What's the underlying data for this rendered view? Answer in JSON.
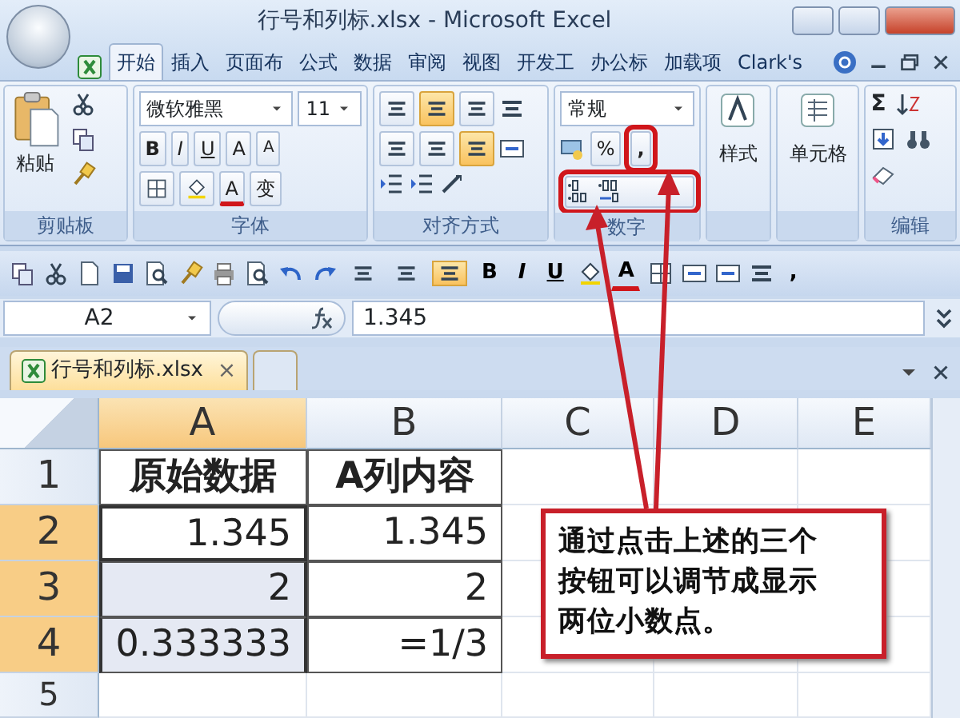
{
  "window": {
    "title": "行号和列标.xlsx - Microsoft Excel"
  },
  "tabs": [
    {
      "label": "开始",
      "selected": true
    },
    {
      "label": "插入",
      "selected": false
    },
    {
      "label": "页面布",
      "selected": false
    },
    {
      "label": "公式",
      "selected": false
    },
    {
      "label": "数据",
      "selected": false
    },
    {
      "label": "审阅",
      "selected": false
    },
    {
      "label": "视图",
      "selected": false
    },
    {
      "label": "开发工",
      "selected": false
    },
    {
      "label": "办公标",
      "selected": false
    },
    {
      "label": "加载项",
      "selected": false
    },
    {
      "label": "Clark's",
      "selected": false
    }
  ],
  "ribbon": {
    "groups": [
      {
        "kind": "clipboard",
        "label": "剪贴板",
        "paste": "粘贴"
      },
      {
        "kind": "font",
        "label": "字体",
        "font_name": "微软雅黑",
        "font_size": "11",
        "bold": "B",
        "italic": "I",
        "underline": "U",
        "grow": "A",
        "shrink": "A",
        "font_color": "A",
        "phonetic": "变"
      },
      {
        "kind": "alignment",
        "label": "对齐方式",
        "vertical": [
          {
            "selected": false
          },
          {
            "selected": true
          },
          {
            "selected": false
          }
        ],
        "horizontal": [
          {
            "selected": false
          },
          {
            "selected": false
          },
          {
            "selected": true
          }
        ]
      },
      {
        "kind": "number",
        "label": "数字",
        "format": "常规",
        "percent": "%",
        "comma": ",",
        "comma_highlighted": true,
        "decimals_highlighted": true
      },
      {
        "kind": "styles",
        "label": "样式"
      },
      {
        "kind": "cells",
        "label": "单元格"
      },
      {
        "kind": "editing",
        "label": "编辑",
        "sum": "Σ"
      }
    ]
  },
  "quick_toolbar": {
    "alignment": [
      {
        "selected": false
      },
      {
        "selected": false
      },
      {
        "selected": true
      }
    ],
    "bold": "B",
    "italic": "I",
    "underline": "U",
    "font_color": "A",
    "comma": ","
  },
  "formula_bar": {
    "name_box": "A2",
    "value": "1.345"
  },
  "workbook_tab": {
    "label": "行号和列标.xlsx",
    "close": "×"
  },
  "sheet": {
    "columns": [
      {
        "label": "A",
        "selected": true
      },
      {
        "label": "B",
        "selected": false
      },
      {
        "label": "C",
        "selected": false
      },
      {
        "label": "D",
        "selected": false
      },
      {
        "label": "E",
        "selected": false
      }
    ],
    "rows": [
      {
        "label": "1",
        "selected": false,
        "cells": [
          {
            "value": "原始数据",
            "bold": true,
            "selected": false,
            "active": false
          },
          {
            "value": "A列内容",
            "bold": true,
            "selected": false,
            "active": false
          }
        ]
      },
      {
        "label": "2",
        "selected": true,
        "cells": [
          {
            "value": "1.345",
            "bold": false,
            "selected": true,
            "active": true
          },
          {
            "value": "1.345",
            "bold": false,
            "selected": false,
            "active": false
          }
        ]
      },
      {
        "label": "3",
        "selected": true,
        "cells": [
          {
            "value": "2",
            "bold": false,
            "selected": true,
            "active": false
          },
          {
            "value": "2",
            "bold": false,
            "selected": false,
            "active": false
          }
        ]
      },
      {
        "label": "4",
        "selected": true,
        "cells": [
          {
            "value": "0.333333",
            "bold": false,
            "selected": true,
            "active": false
          },
          {
            "value": "=1/3",
            "bold": false,
            "selected": false,
            "active": false
          }
        ]
      },
      {
        "label": "5",
        "selected": false,
        "cells": []
      }
    ]
  },
  "annotation": {
    "text": "通过点击上述的三个按钮可以调节成显示两位小数点。"
  }
}
